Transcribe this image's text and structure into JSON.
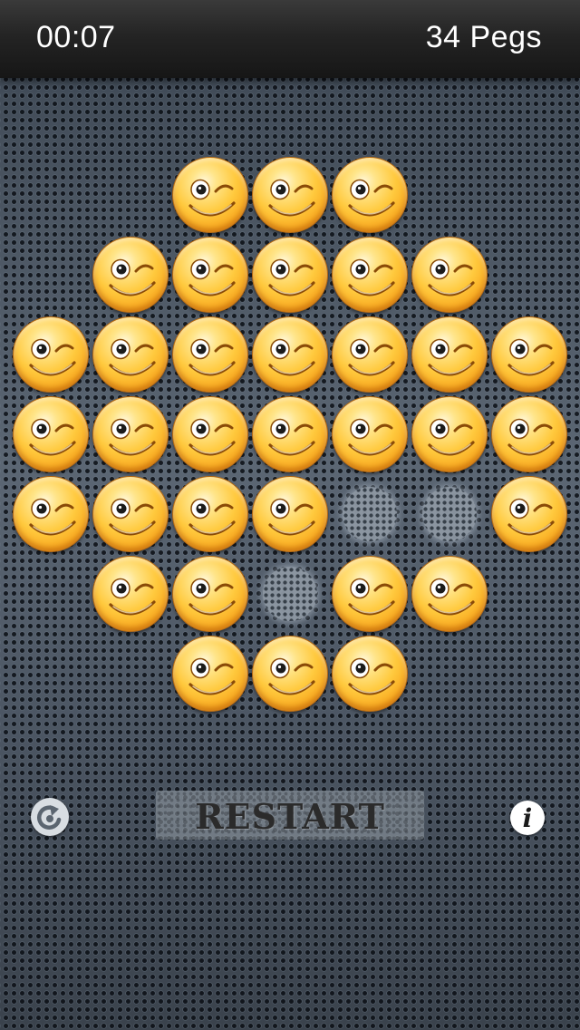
{
  "header": {
    "timer": "00:07",
    "peg_count": "34 Pegs"
  },
  "board": {
    "rows": [
      [
        null,
        null,
        1,
        1,
        1,
        null,
        null
      ],
      [
        null,
        1,
        1,
        1,
        1,
        1,
        null
      ],
      [
        1,
        1,
        1,
        1,
        1,
        1,
        1
      ],
      [
        1,
        1,
        1,
        1,
        1,
        1,
        1
      ],
      [
        1,
        1,
        1,
        1,
        0,
        0,
        1
      ],
      [
        null,
        1,
        1,
        0,
        1,
        1,
        null
      ],
      [
        null,
        null,
        1,
        1,
        1,
        null,
        null
      ]
    ],
    "peg_icon": "winking-smiley-peg",
    "hole_icon": "empty-hole"
  },
  "controls": {
    "undo_icon": "undo-icon",
    "restart_label": "RESTART",
    "info_icon": "info-icon"
  },
  "colors": {
    "peg": "#ffc93d",
    "peg_edge": "#d27a0c",
    "background": "#4a5460",
    "header": "#1e1e1e"
  }
}
